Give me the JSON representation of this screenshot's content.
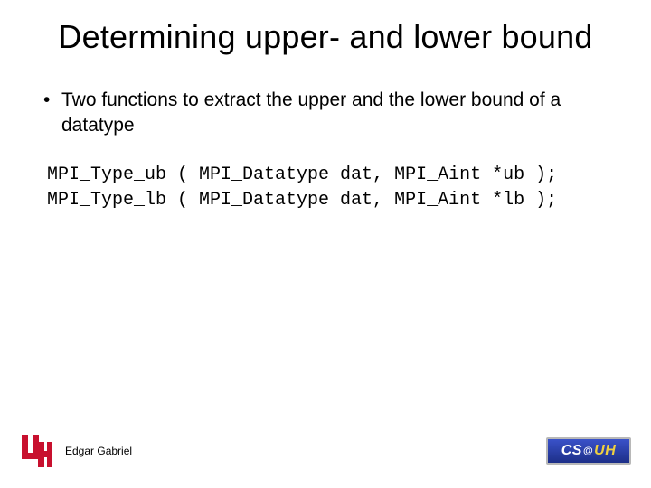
{
  "title": "Determining upper- and lower bound",
  "bullet_marker": "•",
  "bullet_text": "Two functions to extract the upper and the lower bound of a datatype",
  "code_line1": "MPI_Type_ub ( MPI_Datatype dat, MPI_Aint *ub );",
  "code_line2": "MPI_Type_lb ( MPI_Datatype dat, MPI_Aint *lb );",
  "author": "Edgar Gabriel",
  "badge": {
    "cs": "CS",
    "at": "@",
    "uh": "UH"
  }
}
